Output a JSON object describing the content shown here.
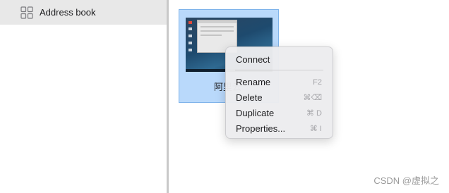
{
  "sidebar": {
    "items": [
      {
        "label": "Address book",
        "icon": "grid-icon"
      }
    ]
  },
  "connection": {
    "name": "阿里云",
    "selected": true
  },
  "context_menu": {
    "items": [
      {
        "label": "Connect",
        "shortcut": ""
      },
      {
        "label": "Rename",
        "shortcut": "F2"
      },
      {
        "label": "Delete",
        "shortcut": "⌘⌫"
      },
      {
        "label": "Duplicate",
        "shortcut": "⌘ D"
      },
      {
        "label": "Properties...",
        "shortcut": "⌘ I"
      }
    ]
  },
  "watermark": {
    "text": "CSDN @虚拟之"
  },
  "colors": {
    "selection_bg": "#b9d9fb",
    "selection_border": "#7eb3ea",
    "sidebar_active": "#e8e8e8"
  }
}
